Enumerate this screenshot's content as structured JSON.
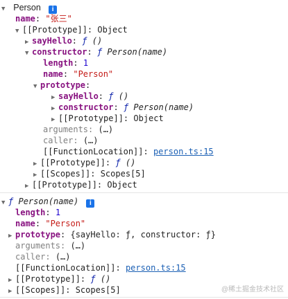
{
  "obj1": {
    "header": "Person",
    "name_key": "name",
    "name_value": "\"张三\"",
    "proto_label": "[[Prototype]]",
    "proto_value": "Object",
    "sayhello_key": "sayHello",
    "f_glyph": "ƒ",
    "sayhello_sig": "()",
    "constructor_key": "constructor",
    "constructor_sig": "Person(name)",
    "length_key": "length",
    "length_value": "1",
    "cname_key": "name",
    "cname_value": "\"Person\"",
    "prototype_key": "prototype",
    "inner_sayhello_key": "sayHello",
    "inner_sayhello_sig": "()",
    "inner_constructor_key": "constructor",
    "inner_constructor_sig": "Person(name)",
    "inner_proto_label": "[[Prototype]]",
    "inner_proto_value": "Object",
    "arguments_key": "arguments",
    "arguments_value": "(…)",
    "caller_key": "caller",
    "caller_value": "(…)",
    "fnloc_key": "[[FunctionLocation]]",
    "fnloc_link": "person.ts:15",
    "cproto_label": "[[Prototype]]",
    "cproto_sig": "()",
    "scopes_label": "[[Scopes]]",
    "scopes_value": "Scopes[5]",
    "outer_proto_label": "[[Prototype]]",
    "outer_proto_value": "Object"
  },
  "obj2": {
    "f_glyph": "ƒ",
    "header_sig": "Person(name)",
    "length_key": "length",
    "length_value": "1",
    "name_key": "name",
    "name_value": "\"Person\"",
    "prototype_key": "prototype",
    "prototype_value": "{sayHello: ƒ, constructor: ƒ}",
    "arguments_key": "arguments",
    "arguments_value": "(…)",
    "caller_key": "caller",
    "caller_value": "(…)",
    "fnloc_key": "[[FunctionLocation]]",
    "fnloc_link": "person.ts:15",
    "proto_label": "[[Prototype]]",
    "proto_sig": "()",
    "scopes_label": "[[Scopes]]",
    "scopes_value": "Scopes[5]"
  },
  "icons": {
    "info": "i",
    "expanded": "▼",
    "collapsed": "▶"
  },
  "watermark": "@稀土掘金技术社区"
}
